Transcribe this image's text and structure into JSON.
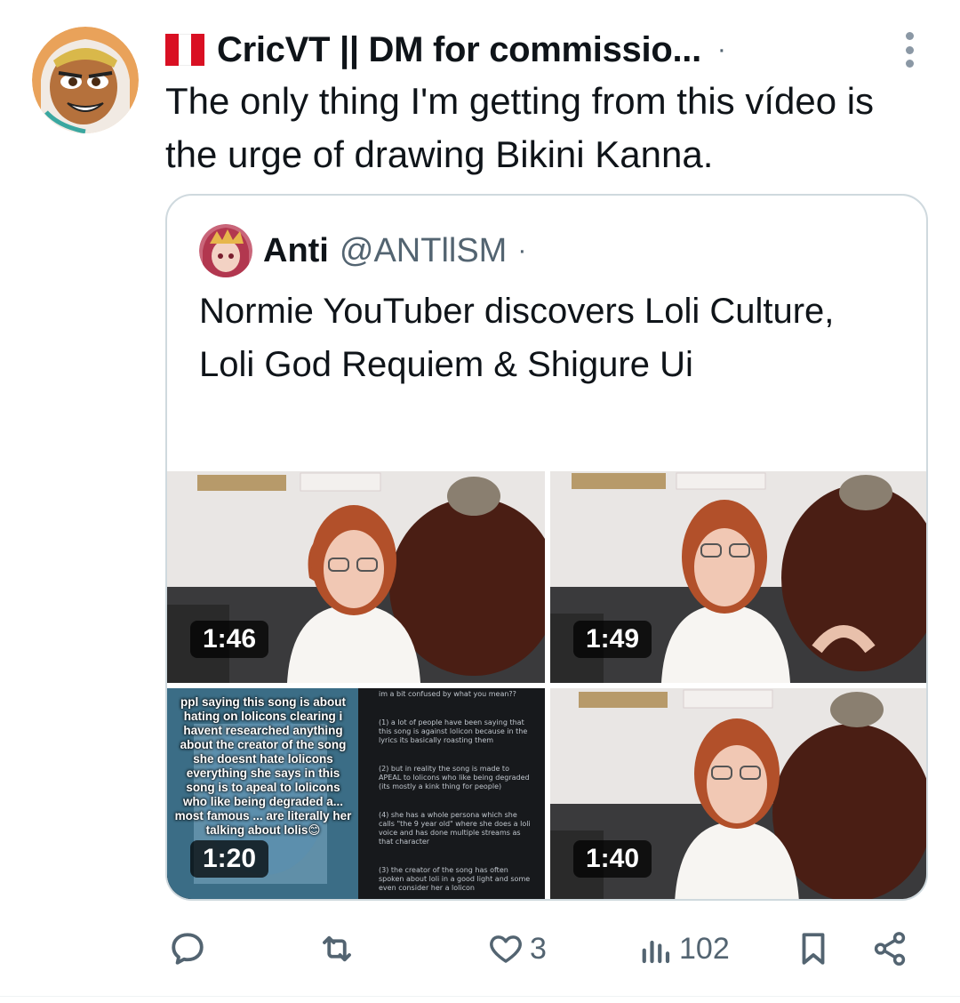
{
  "tweet": {
    "author": "CricVT || DM for commissio...",
    "separator": "·",
    "text": "The only thing I'm getting from this vídeo is the urge of drawing Bikini Kanna."
  },
  "quoted": {
    "name": "Anti",
    "handle": "@ANTllSM",
    "separator": "·",
    "text": "Normie YouTuber discovers Loli Culture, Loli God Requiem & Shigure Ui",
    "media": [
      {
        "duration": "1:46"
      },
      {
        "duration": "1:49"
      },
      {
        "duration": "1:20",
        "caption": "ppl saying this song is about hating on lolicons clearing i havent researched anything about the creator of the song she doesnt hate lolicons everything she says in this song is to apeal to lolicons who like being degraded a... most famous ... are literally her talking about lolis😊"
      },
      {
        "duration": "1:40"
      }
    ],
    "comments": [
      "im a bit confused by what you mean??",
      "(1) a lot of people have been saying that this song is against lolicon because in the lyrics its basically roasting them",
      "(2) but in reality the song is made to APEAL to lolicons who like being degraded (its mostly a kink thing for people)",
      "(4) she has a whole persona which she calls \"the 9 year old\" where she does a loli voice and has done multiple streams as that character",
      "(3) the creator of the song has often spoken about loli in a good light and some even consider her a lolicon"
    ]
  },
  "actions": {
    "reply_count": "",
    "retweet_count": "",
    "like_count": "3",
    "views_count": "102"
  },
  "colors": {
    "text": "#0f1419",
    "secondary": "#536471",
    "border": "#cfd9de"
  }
}
